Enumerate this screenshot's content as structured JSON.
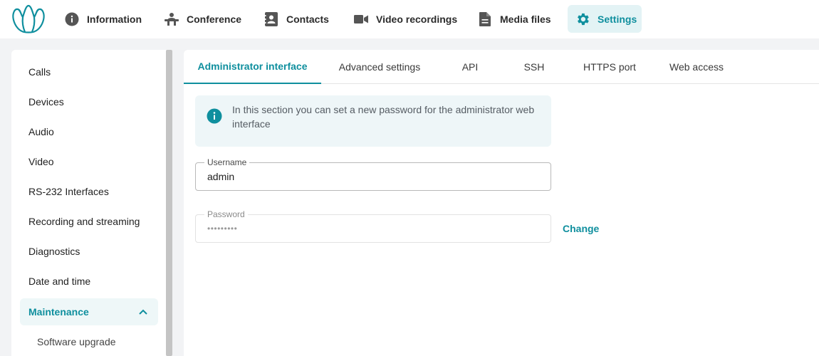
{
  "colors": {
    "accent": "#0f8f9e",
    "accent_bg": "#e3f3f5",
    "info_bg": "#eef6f8",
    "page_bg": "#f2f3f5"
  },
  "topnav": {
    "logo_icon": "people-group-logo",
    "items": [
      {
        "label": "Information",
        "icon": "info-circle-icon"
      },
      {
        "label": "Conference",
        "icon": "conference-desk-icon"
      },
      {
        "label": "Contacts",
        "icon": "contacts-book-icon"
      },
      {
        "label": "Video recordings",
        "icon": "video-camera-icon"
      },
      {
        "label": "Media files",
        "icon": "document-icon"
      },
      {
        "label": "Settings",
        "icon": "gear-icon",
        "active": true
      }
    ]
  },
  "sidebar": {
    "items": [
      {
        "label": "Calls"
      },
      {
        "label": "Devices"
      },
      {
        "label": "Audio"
      },
      {
        "label": "Video"
      },
      {
        "label": "RS-232 Interfaces"
      },
      {
        "label": "Recording and streaming"
      },
      {
        "label": "Diagnostics"
      },
      {
        "label": "Date and time"
      },
      {
        "label": "Maintenance",
        "active": true,
        "expanded": true
      },
      {
        "label": "Software upgrade",
        "sub": true
      }
    ]
  },
  "tabs": [
    {
      "label": "Administrator interface",
      "active": true
    },
    {
      "label": "Advanced settings"
    },
    {
      "label": "API"
    },
    {
      "label": "SSH"
    },
    {
      "label": "HTTPS port"
    },
    {
      "label": "Web access"
    }
  ],
  "info_box": {
    "icon": "info-circle-icon",
    "text": "In this section you can set a new password for the administrator web interface"
  },
  "form": {
    "username": {
      "label": "Username",
      "value": "admin"
    },
    "password": {
      "label": "Password",
      "value": "•••••••••",
      "disabled": true
    },
    "change_label": "Change"
  }
}
